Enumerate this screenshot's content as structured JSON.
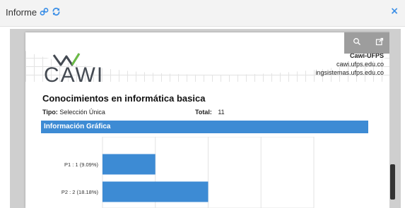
{
  "modal": {
    "title": "Informe",
    "title_icons": [
      "link-icon",
      "refresh-icon"
    ],
    "close_label": "×"
  },
  "viewer": {
    "toolbar": {
      "search_icon": "zoom-icon",
      "open_icon": "open-external-icon"
    }
  },
  "document": {
    "logo_text": "CAWI",
    "org": {
      "name": "Cawi-UFPS",
      "site1": "cawi.ufps.edu.co",
      "site2": "ingsistemas.ufps.edu.co"
    },
    "title": "Conocimientos en informática basica",
    "type_label": "Tipo:",
    "type_value": "Selección Única",
    "total_label": "Total:",
    "total_value": "11",
    "section_title": "Información Gráfica"
  },
  "colors": {
    "accent": "#3a8ee6",
    "section_bar": "#3d8bd4",
    "bar": "#3d8bd4"
  },
  "chart_data": {
    "type": "bar",
    "orientation": "horizontal",
    "categories": [
      "P1 : 1 (9.09%)",
      "P2 : 2 (18.18%)"
    ],
    "values": [
      1,
      2
    ],
    "xlim": [
      0,
      4
    ],
    "grid": true
  }
}
